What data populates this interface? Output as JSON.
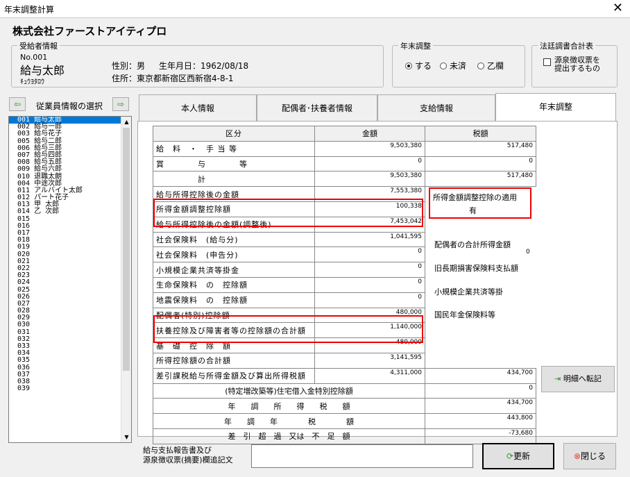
{
  "window": {
    "title": "年末調整計算",
    "close": "✕"
  },
  "company": "株式会社ファーストアイティプロ",
  "recipient": {
    "group": "受給者情報",
    "no": "No.001",
    "name": "給与太郎",
    "kana": "ｷｭｳﾖﾀﾛｳ",
    "gender": "性別：男",
    "birth": "生年月日：1962/08/18",
    "address": "住所：東京都新宿区西新宿4-8-1"
  },
  "year_end": {
    "group": "年末調整",
    "opt1": "する",
    "opt2": "未済",
    "opt3": "乙欄"
  },
  "legal": {
    "group": "法廷調書合計表",
    "line1": "源泉徴収票を",
    "line2": "提出するもの"
  },
  "employee_select": {
    "label": "従業員情報の選択",
    "prev": "⇦",
    "next": "⇨"
  },
  "employees": [
    "001 給与太郎",
    "002 給与一郎",
    "003 給与花子",
    "005 給与二郎",
    "006 給与三郎",
    "007 給与四郎",
    "008 給与五郎",
    "009 給与六郎",
    "010 退職太朗",
    "004 中途次郎",
    "011 アルバイト太郎",
    "012 パート花子",
    "013 甲 太郎",
    "014 乙 次郎",
    "015",
    "016",
    "017",
    "018",
    "019",
    "020",
    "021",
    "022",
    "023",
    "024",
    "025",
    "026",
    "027",
    "028",
    "029",
    "030",
    "031",
    "032",
    "033",
    "034",
    "035",
    "036",
    "037",
    "038",
    "039"
  ],
  "tabs": [
    "本人情報",
    "配偶者･扶養者情報",
    "支給情報",
    "年末調整"
  ],
  "table": {
    "headers": [
      "区分",
      "金額",
      "税額"
    ],
    "rows": [
      {
        "label": "給　料　・　手 当 等",
        "amount": "9,503,380",
        "tax": "517,480"
      },
      {
        "label": "賞　　　　与　　　　等",
        "amount": "0",
        "tax": "0"
      },
      {
        "label": "　　　　　計",
        "amount": "9,503,380",
        "tax": "517,480"
      },
      {
        "label": "給与所得控除後の金額",
        "amount": "7,553,380"
      },
      {
        "label": "所得金額調整控除額",
        "amount": "100,338"
      },
      {
        "label": "給与所得控除後の金額(調整後)",
        "amount": "7,453,042"
      },
      {
        "label": "社会保険料　(給与分)",
        "amount": "1,041,595"
      },
      {
        "label": "社会保険料　(申告分)",
        "amount": "0"
      },
      {
        "label": "小規模企業共済等掛金",
        "amount": "0"
      },
      {
        "label": "生命保険料　の　控除額",
        "amount": "0"
      },
      {
        "label": "地震保険料　の　控除額",
        "amount": "0"
      },
      {
        "label": "配偶者(特別)控除額",
        "amount": "480,000"
      },
      {
        "label": "扶養控除及び障害者等の控除額の合計額",
        "amount": "1,140,000"
      },
      {
        "label": "基　礎　控　除　額",
        "amount": "480,000"
      },
      {
        "label": "所得控除額の合計額",
        "amount": "3,141,595"
      },
      {
        "label": "差引課税給与所得金額及び算出所得税額",
        "amount": "4,311,000",
        "tax": "434,700"
      }
    ],
    "wide_rows": [
      {
        "label": "(特定増改築等)住宅借入金特別控除額",
        "tax": "0"
      },
      {
        "label": "年　　調　　所　　得　　税　　額",
        "tax": "434,700"
      },
      {
        "label": "年　　調　　年　　　　税　　　　額",
        "tax": "443,800"
      },
      {
        "label": "差　引　超　過　又は　不　足　額",
        "tax": "-73,680"
      }
    ]
  },
  "side_info": {
    "adjustment_title": "所得金額調整控除の適用",
    "adjustment_value": "有",
    "spouse_income": "配偶者の合計所得金額",
    "spouse_income_value": "0",
    "old_insurance": "旧長期損害保険料支払額",
    "small_biz": "小規模企業共済等掛",
    "pension": "国民年金保険料等"
  },
  "buttons": {
    "transfer": "明細へ転記",
    "update": "更新",
    "close": "閉じる"
  },
  "footer": {
    "label1": "給与支払報告書及び",
    "label2": "源泉徴収票(摘要)欄追記文",
    "input_value": ""
  },
  "colors": {
    "highlight": "#e00000",
    "selection": "#0078d7",
    "nav_arrow": "#2a9a2a"
  }
}
